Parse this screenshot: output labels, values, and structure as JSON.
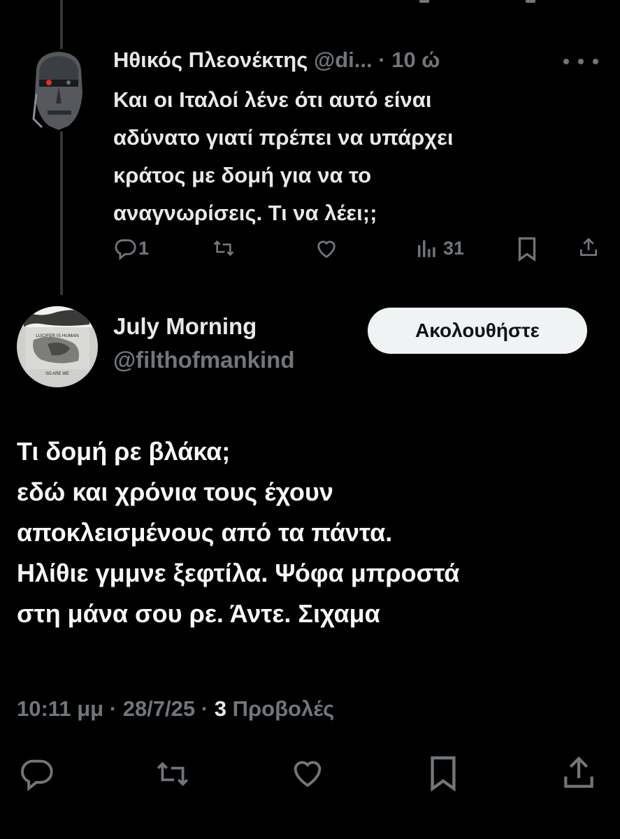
{
  "parent_tweet": {
    "display_name": "Ηθικός Πλεονέκτης",
    "handle": "@di...",
    "separator": "·",
    "time": "10 ώ",
    "text_lines": [
      "Και οι Ιταλοί λένε ότι αυτό είναι",
      "αδύνατο γιατί πρέπει να υπάρχει",
      "κράτος με δομή για να το",
      "αναγνωρίσεις. Τι να λέει;;"
    ],
    "replies": "1",
    "views": "31",
    "icons": [
      "reply-icon",
      "retweet-icon",
      "like-icon",
      "views-icon",
      "bookmark-icon",
      "share-icon",
      "more-icon"
    ]
  },
  "main_tweet": {
    "display_name": "July Morning",
    "handle": "@filthofmankind",
    "follow_label": "Ακολουθήστε",
    "avatar_text": {
      "top": "LUCIFER IS HUMAN",
      "bottom": "SO ARE WE"
    },
    "text_lines": [
      "Τι δομή ρε βλάκα;",
      "εδώ και χρόνια τους έχουν",
      "αποκλεισμένους από τα πάντα.",
      "Ηλίθιε γμμνε ξεφτίλα. Ψόφα μπροστά",
      "στη μάνα σου ρε. Άντε. Σιχαμα"
    ],
    "meta": {
      "time": "10:11 μμ",
      "date": "28/7/25",
      "views_count": "3",
      "views_label": "Προβολές",
      "separator": "·"
    },
    "icons": [
      "reply-icon",
      "retweet-icon",
      "like-icon",
      "bookmark-icon",
      "share-icon"
    ]
  },
  "colors": {
    "background": "#000000",
    "text": "#e7e9ea",
    "muted": "#71767b",
    "button_bg": "#eff3f4"
  }
}
